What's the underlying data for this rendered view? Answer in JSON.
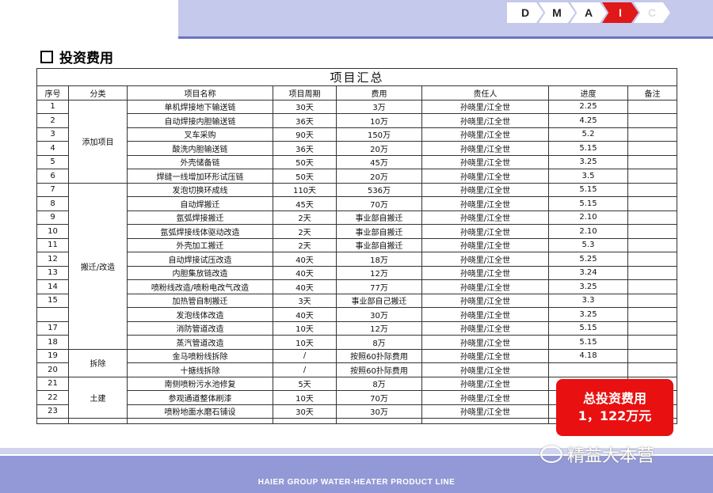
{
  "header": {
    "stages": [
      "D",
      "M",
      "A",
      "I",
      "C"
    ],
    "active_stage": "I"
  },
  "section_title": "投资费用",
  "table": {
    "caption": "项目汇总",
    "headers": [
      "序号",
      "分类",
      "项目名称",
      "项目周期",
      "费用",
      "责任人",
      "进度",
      "备注"
    ],
    "groups": [
      {
        "category": "添加项目",
        "rows": [
          [
            "1",
            "单机焊接地下输送链",
            "30天",
            "3万",
            "孙晓里/江全世",
            "2.25",
            ""
          ],
          [
            "2",
            "自动焊接内胆输送链",
            "36天",
            "10万",
            "孙晓里/江全世",
            "4.25",
            ""
          ],
          [
            "3",
            "叉车采购",
            "90天",
            "150万",
            "孙晓里/江全世",
            "5.2",
            ""
          ],
          [
            "4",
            "酸洗内胆输送链",
            "36天",
            "20万",
            "孙晓里/江全世",
            "5.15",
            ""
          ],
          [
            "5",
            "外壳储备链",
            "50天",
            "45万",
            "孙晓里/江全世",
            "3.25",
            ""
          ],
          [
            "6",
            "焊缝一线增加环形试压链",
            "50天",
            "20万",
            "孙晓里/江全世",
            "3.5",
            ""
          ]
        ]
      },
      {
        "category": "搬迁/改造",
        "rows": [
          [
            "7",
            "发泡切换环成线",
            "110天",
            "536万",
            "孙晓里/江全世",
            "5.15",
            ""
          ],
          [
            "8",
            "自动焊搬迁",
            "45天",
            "70万",
            "孙晓里/江全世",
            "5.15",
            ""
          ],
          [
            "9",
            "氩弧焊接搬迁",
            "2天",
            "事业部自搬迁",
            "孙晓里/江全世",
            "2.10",
            ""
          ],
          [
            "10",
            "氩弧焊接线体驱动改造",
            "2天",
            "事业部自搬迁",
            "孙晓里/江全世",
            "2.10",
            ""
          ],
          [
            "11",
            "外壳加工搬迁",
            "2天",
            "事业部自搬迁",
            "孙晓里/江全世",
            "5.3",
            ""
          ],
          [
            "12",
            "自动焊接试压改造",
            "40天",
            "18万",
            "孙晓里/江全世",
            "5.25",
            ""
          ],
          [
            "13",
            "内胆集放链改造",
            "40天",
            "12万",
            "孙晓里/江全世",
            "3.24",
            ""
          ],
          [
            "14",
            "喷粉线改造/喷粉电改气改造",
            "40天",
            "77万",
            "孙晓里/江全世",
            "3.25",
            ""
          ],
          [
            "15",
            "加热管自制搬迁",
            "3天",
            "事业部自己搬迁",
            "孙晓里/江全世",
            "3.3",
            ""
          ],
          [
            "",
            "发泡线体改造",
            "40天",
            "30万",
            "孙晓里/江全世",
            "3.25",
            ""
          ],
          [
            "17",
            "消防管道改造",
            "10天",
            "12万",
            "孙晓里/江全世",
            "5.15",
            ""
          ],
          [
            "18",
            "蒸汽管道改造",
            "10天",
            "8万",
            "孙晓里/江全世",
            "5.15",
            ""
          ]
        ]
      },
      {
        "category": "拆除",
        "rows": [
          [
            "19",
            "金马喷粉线拆除",
            "/",
            "按照60扑际费用",
            "孙晓里/江全世",
            "4.18",
            ""
          ],
          [
            "20",
            "十搪线拆除",
            "/",
            "按照60扑际费用",
            "孙晓里/江全世",
            "",
            ""
          ]
        ]
      },
      {
        "category": "土建",
        "rows": [
          [
            "21",
            "南侧喷粉污水池修复",
            "5天",
            "8万",
            "孙晓里/江全世",
            "",
            ""
          ],
          [
            "22",
            "参观通道整体刷漆",
            "10天",
            "70万",
            "孙晓里/江全世",
            "",
            ""
          ],
          [
            "23",
            "喷粉地面水磨石铺设",
            "30天",
            "30万",
            "孙晓里/江全世",
            "",
            ""
          ]
        ]
      }
    ]
  },
  "callout": {
    "line1": "总投资费用",
    "line2": "1，122万元"
  },
  "watermark": "精益大本营",
  "footer": "HAIER GROUP WATER-HEATER PRODUCT LINE"
}
